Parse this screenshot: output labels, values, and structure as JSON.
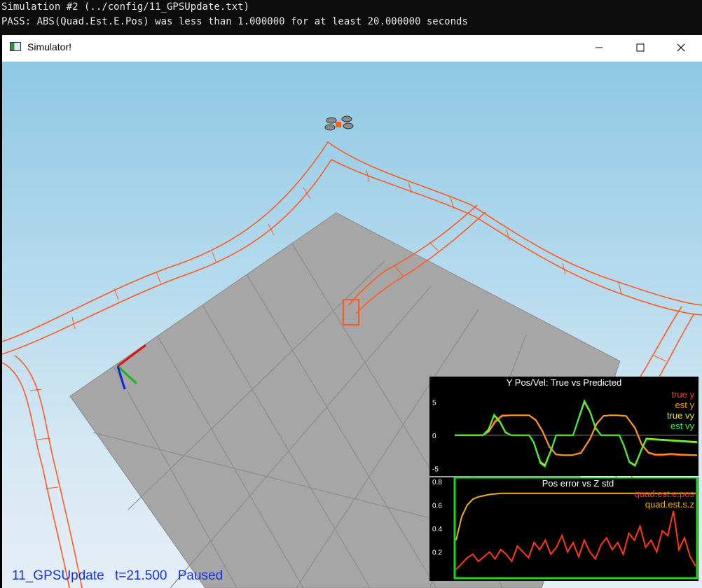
{
  "console": {
    "line1": "Simulation #2 (../config/11_GPSUpdate.txt)",
    "line2": "PASS: ABS(Quad.Est.E.Pos) was less than 1.000000 for at least 20.000000 seconds"
  },
  "window": {
    "title": "Simulator!",
    "icon": "app-window-icon",
    "minimize_icon": "minimize-icon",
    "maximize_icon": "maximize-icon",
    "close_icon": "close-icon"
  },
  "status": {
    "scenario": "11_GPSUpdate",
    "time": "t=21.500",
    "state": "Paused"
  },
  "colors": {
    "sky_top": "#8ec8e4",
    "trail": "#ff5a1f",
    "floor": "#a6a6a6",
    "status_text": "#1133dd",
    "plot_bg": "#000000",
    "plot_border": "#21d321"
  },
  "chart_data": [
    {
      "type": "line",
      "title": "Y Pos/Vel: True vs Predicted",
      "ylim": [
        -5.5,
        6.5
      ],
      "yticks": [
        "5",
        "0",
        "-5"
      ],
      "xlim": [
        0,
        21.5
      ],
      "grid": false,
      "legend_position": "top-right",
      "series": [
        {
          "name": "true y",
          "color": "#ff3a12",
          "x": [
            0,
            2.5,
            3.0,
            3.6,
            4.2,
            5.0,
            5.8,
            6.6,
            7.2,
            7.8,
            8.4,
            9.0,
            9.6,
            10.4,
            11.2,
            12.0,
            12.6,
            13.2,
            13.8,
            14.4,
            15.2,
            16.0,
            16.6,
            17.2,
            17.8,
            18.4,
            19.2,
            20.0,
            21.5
          ],
          "y": [
            0,
            0,
            0.6,
            2.2,
            3.0,
            3.0,
            3.0,
            3.0,
            2.2,
            0.5,
            -1.8,
            -2.9,
            -3.0,
            -3.0,
            -2.6,
            -0.5,
            1.8,
            2.9,
            3.0,
            3.0,
            2.9,
            1.0,
            -1.5,
            -2.7,
            -3.0,
            -3.0,
            -2.9,
            -3.0,
            -3.0
          ]
        },
        {
          "name": "est y",
          "color": "#f0a020",
          "x": [
            0,
            2.5,
            3.0,
            3.6,
            4.2,
            5.0,
            5.8,
            6.6,
            7.2,
            7.8,
            8.4,
            9.0,
            9.6,
            10.4,
            11.2,
            12.0,
            12.6,
            13.2,
            13.8,
            14.4,
            15.2,
            16.0,
            16.6,
            17.2,
            17.8,
            18.4,
            19.2,
            20.0,
            21.5
          ],
          "y": [
            0,
            0,
            0.5,
            2.0,
            2.9,
            3.0,
            3.0,
            3.0,
            2.3,
            0.6,
            -1.7,
            -2.9,
            -3.0,
            -3.0,
            -2.7,
            -0.6,
            1.7,
            2.9,
            3.0,
            3.0,
            2.9,
            1.1,
            -1.4,
            -2.6,
            -2.9,
            -2.9,
            -2.8,
            -2.9,
            -3.0
          ]
        },
        {
          "name": "true vy",
          "color": "#e6e600",
          "x": [
            0,
            2.5,
            3.0,
            3.5,
            4.0,
            4.5,
            5.0,
            6.6,
            7.0,
            7.6,
            8.0,
            8.6,
            9.0,
            10.5,
            11.0,
            11.5,
            12.0,
            12.5,
            13.0,
            14.6,
            15.0,
            15.5,
            16.0,
            16.6,
            17.0,
            21.5
          ],
          "y": [
            0,
            0,
            0.8,
            3.0,
            2.0,
            0.4,
            0,
            0,
            -1.0,
            -4.0,
            -4.5,
            -2.0,
            0,
            0,
            2.5,
            5.0,
            3.5,
            1.0,
            0,
            0,
            -1.5,
            -4.0,
            -4.5,
            -2.0,
            -0.5,
            -1.0
          ]
        },
        {
          "name": "est vy",
          "color": "#3ef03e",
          "x": [
            0,
            2.5,
            3.0,
            3.5,
            4.0,
            4.5,
            5.0,
            6.6,
            7.0,
            7.6,
            8.0,
            8.6,
            9.0,
            10.5,
            11.0,
            11.5,
            12.0,
            12.5,
            13.0,
            14.6,
            15.0,
            15.5,
            16.0,
            16.6,
            17.0,
            21.5
          ],
          "y": [
            0,
            0,
            0.9,
            3.1,
            2.1,
            0.5,
            0,
            0,
            -1.1,
            -4.2,
            -4.7,
            -2.1,
            0,
            0,
            2.6,
            5.2,
            3.6,
            1.1,
            0,
            0,
            -1.6,
            -4.1,
            -4.6,
            -2.1,
            -0.6,
            -1.1
          ]
        }
      ]
    },
    {
      "type": "line",
      "title": "Pos error vs Z std",
      "ylim": [
        0,
        0.8
      ],
      "yticks": [
        "0.8",
        "0.6",
        "0.4",
        "0.2"
      ],
      "xlim": [
        0,
        21.5
      ],
      "grid": false,
      "legend_position": "top-right",
      "series": [
        {
          "name": "quad.est.e.pos",
          "color": "#ff3a12",
          "x": [
            0,
            0.5,
            1,
            1.5,
            2,
            2.5,
            3,
            3.5,
            4,
            4.5,
            5,
            5.5,
            6,
            6.5,
            7,
            7.5,
            8,
            8.5,
            9,
            9.5,
            10,
            10.5,
            11,
            11.5,
            12,
            12.5,
            13,
            13.5,
            14,
            14.5,
            15,
            15.5,
            16,
            16.5,
            17,
            17.5,
            18,
            18.5,
            19,
            19.5,
            20,
            20.5,
            21,
            21.5
          ],
          "y": [
            0.05,
            0.1,
            0.15,
            0.18,
            0.12,
            0.16,
            0.2,
            0.14,
            0.22,
            0.18,
            0.12,
            0.25,
            0.2,
            0.15,
            0.28,
            0.22,
            0.3,
            0.18,
            0.24,
            0.34,
            0.2,
            0.28,
            0.16,
            0.3,
            0.2,
            0.14,
            0.26,
            0.32,
            0.22,
            0.28,
            0.18,
            0.36,
            0.3,
            0.42,
            0.24,
            0.3,
            0.2,
            0.38,
            0.34,
            0.55,
            0.22,
            0.32,
            0.16,
            0.08
          ]
        },
        {
          "name": "quad.est.s.z",
          "color": "#f0b020",
          "x": [
            0,
            0.5,
            1,
            1.5,
            2,
            2.5,
            3,
            3.5,
            4,
            5,
            21.5
          ],
          "y": [
            0.3,
            0.5,
            0.6,
            0.65,
            0.67,
            0.68,
            0.69,
            0.695,
            0.7,
            0.7,
            0.7
          ]
        }
      ]
    }
  ]
}
